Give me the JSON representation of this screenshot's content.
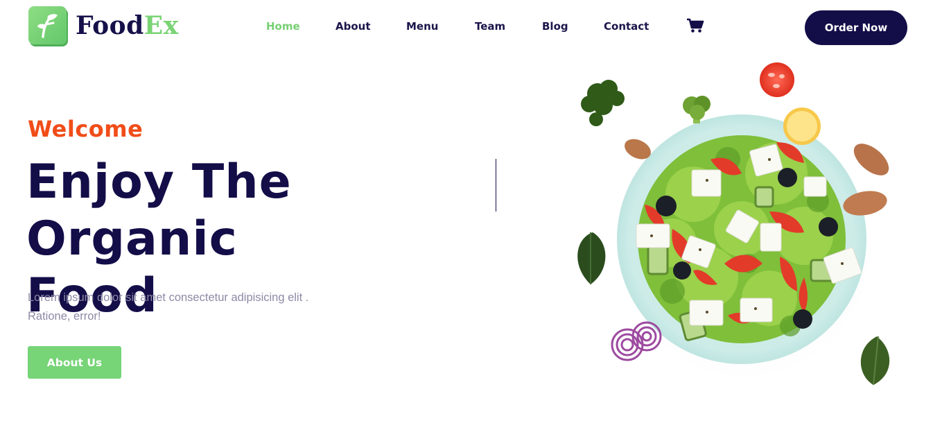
{
  "header": {
    "logo": {
      "text_part1": "Food",
      "text_part2": "Ex",
      "icon": "leaf-f-logo-icon"
    },
    "nav": [
      {
        "label": "Home",
        "active": true
      },
      {
        "label": "About",
        "active": false
      },
      {
        "label": "Menu",
        "active": false
      },
      {
        "label": "Team",
        "active": false
      },
      {
        "label": "Blog",
        "active": false
      },
      {
        "label": "Contact",
        "active": false
      }
    ],
    "cart_icon": "shopping-cart-icon",
    "order_button": "Order Now"
  },
  "hero": {
    "welcome": "Welcome",
    "headline_line1": "Enjoy The Organic",
    "headline_line2": "Food",
    "description": "Lorem ipsum dolor sit amet consectetur adipisicing elit . Ratione, error!",
    "about_button": "About Us",
    "image": "salad-bowl-image"
  },
  "colors": {
    "brand_dark": "#130d48",
    "brand_green": "#77d477",
    "accent_orange": "#f14d19",
    "muted_text": "#8d8aa6"
  }
}
